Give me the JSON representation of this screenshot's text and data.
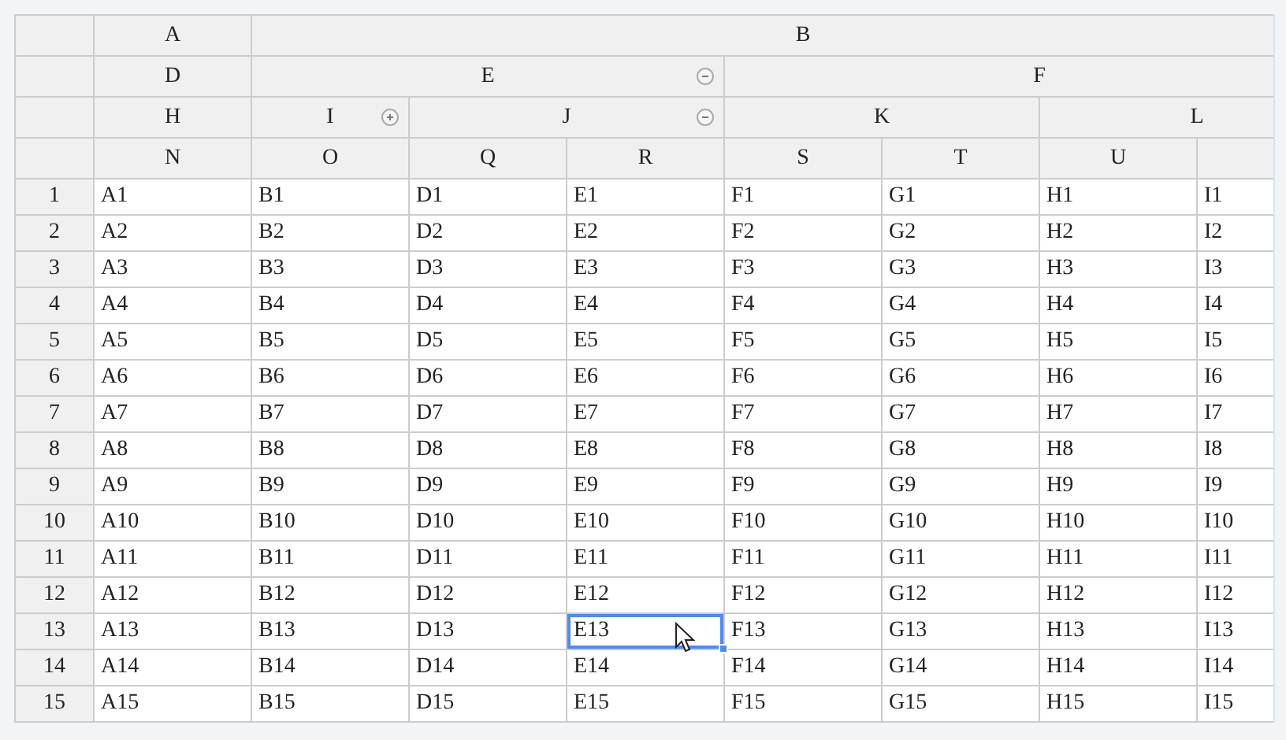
{
  "header_tree": [
    {
      "label": "A",
      "children": [
        {
          "label": "D",
          "children": [
            {
              "label": "H",
              "children": [
                {
                  "label": "N"
                }
              ]
            }
          ]
        }
      ]
    },
    {
      "label": "B",
      "children": [
        {
          "label": "E",
          "collapsible": true,
          "collapsed": false,
          "children": [
            {
              "label": "I",
              "collapsible": true,
              "collapsed": true,
              "children": [
                {
                  "label": "O"
                }
              ]
            },
            {
              "label": "J",
              "collapsible": true,
              "collapsed": false,
              "children": [
                {
                  "label": "Q"
                },
                {
                  "label": "R"
                }
              ]
            }
          ]
        },
        {
          "label": "F",
          "children": [
            {
              "label": "K",
              "children": [
                {
                  "label": "S"
                },
                {
                  "label": "T"
                }
              ]
            },
            {
              "label": "L",
              "children": [
                {
                  "label": "U"
                }
              ]
            }
          ]
        }
      ]
    }
  ],
  "rows": [
    {
      "number": "1",
      "cells": [
        {
          "text": "A1",
          "selected": false
        },
        {
          "text": "B1",
          "selected": false
        },
        {
          "text": "D1",
          "selected": false
        },
        {
          "text": "E1",
          "selected": false
        },
        {
          "text": "F1",
          "selected": false
        },
        {
          "text": "G1",
          "selected": false
        },
        {
          "text": "H1",
          "selected": false
        },
        {
          "text": "I1",
          "selected": false
        }
      ]
    },
    {
      "number": "2",
      "cells": [
        {
          "text": "A2",
          "selected": false
        },
        {
          "text": "B2",
          "selected": false
        },
        {
          "text": "D2",
          "selected": false
        },
        {
          "text": "E2",
          "selected": false
        },
        {
          "text": "F2",
          "selected": false
        },
        {
          "text": "G2",
          "selected": false
        },
        {
          "text": "H2",
          "selected": false
        },
        {
          "text": "I2",
          "selected": false
        }
      ]
    },
    {
      "number": "3",
      "cells": [
        {
          "text": "A3",
          "selected": false
        },
        {
          "text": "B3",
          "selected": false
        },
        {
          "text": "D3",
          "selected": false
        },
        {
          "text": "E3",
          "selected": false
        },
        {
          "text": "F3",
          "selected": false
        },
        {
          "text": "G3",
          "selected": false
        },
        {
          "text": "H3",
          "selected": false
        },
        {
          "text": "I3",
          "selected": false
        }
      ]
    },
    {
      "number": "4",
      "cells": [
        {
          "text": "A4",
          "selected": false
        },
        {
          "text": "B4",
          "selected": false
        },
        {
          "text": "D4",
          "selected": false
        },
        {
          "text": "E4",
          "selected": false
        },
        {
          "text": "F4",
          "selected": false
        },
        {
          "text": "G4",
          "selected": false
        },
        {
          "text": "H4",
          "selected": false
        },
        {
          "text": "I4",
          "selected": false
        }
      ]
    },
    {
      "number": "5",
      "cells": [
        {
          "text": "A5",
          "selected": false
        },
        {
          "text": "B5",
          "selected": false
        },
        {
          "text": "D5",
          "selected": false
        },
        {
          "text": "E5",
          "selected": false
        },
        {
          "text": "F5",
          "selected": false
        },
        {
          "text": "G5",
          "selected": false
        },
        {
          "text": "H5",
          "selected": false
        },
        {
          "text": "I5",
          "selected": false
        }
      ]
    },
    {
      "number": "6",
      "cells": [
        {
          "text": "A6",
          "selected": false
        },
        {
          "text": "B6",
          "selected": false
        },
        {
          "text": "D6",
          "selected": false
        },
        {
          "text": "E6",
          "selected": false
        },
        {
          "text": "F6",
          "selected": false
        },
        {
          "text": "G6",
          "selected": false
        },
        {
          "text": "H6",
          "selected": false
        },
        {
          "text": "I6",
          "selected": false
        }
      ]
    },
    {
      "number": "7",
      "cells": [
        {
          "text": "A7",
          "selected": false
        },
        {
          "text": "B7",
          "selected": false
        },
        {
          "text": "D7",
          "selected": false
        },
        {
          "text": "E7",
          "selected": false
        },
        {
          "text": "F7",
          "selected": false
        },
        {
          "text": "G7",
          "selected": false
        },
        {
          "text": "H7",
          "selected": false
        },
        {
          "text": "I7",
          "selected": false
        }
      ]
    },
    {
      "number": "8",
      "cells": [
        {
          "text": "A8",
          "selected": false
        },
        {
          "text": "B8",
          "selected": false
        },
        {
          "text": "D8",
          "selected": false
        },
        {
          "text": "E8",
          "selected": false
        },
        {
          "text": "F8",
          "selected": false
        },
        {
          "text": "G8",
          "selected": false
        },
        {
          "text": "H8",
          "selected": false
        },
        {
          "text": "I8",
          "selected": false
        }
      ]
    },
    {
      "number": "9",
      "cells": [
        {
          "text": "A9",
          "selected": false
        },
        {
          "text": "B9",
          "selected": false
        },
        {
          "text": "D9",
          "selected": false
        },
        {
          "text": "E9",
          "selected": false
        },
        {
          "text": "F9",
          "selected": false
        },
        {
          "text": "G9",
          "selected": false
        },
        {
          "text": "H9",
          "selected": false
        },
        {
          "text": "I9",
          "selected": false
        }
      ]
    },
    {
      "number": "10",
      "cells": [
        {
          "text": "A10",
          "selected": false
        },
        {
          "text": "B10",
          "selected": false
        },
        {
          "text": "D10",
          "selected": false
        },
        {
          "text": "E10",
          "selected": false
        },
        {
          "text": "F10",
          "selected": false
        },
        {
          "text": "G10",
          "selected": false
        },
        {
          "text": "H10",
          "selected": false
        },
        {
          "text": "I10",
          "selected": false
        }
      ]
    },
    {
      "number": "11",
      "cells": [
        {
          "text": "A11",
          "selected": false
        },
        {
          "text": "B11",
          "selected": false
        },
        {
          "text": "D11",
          "selected": false
        },
        {
          "text": "E11",
          "selected": false
        },
        {
          "text": "F11",
          "selected": false
        },
        {
          "text": "G11",
          "selected": false
        },
        {
          "text": "H11",
          "selected": false
        },
        {
          "text": "I11",
          "selected": false
        }
      ]
    },
    {
      "number": "12",
      "cells": [
        {
          "text": "A12",
          "selected": false
        },
        {
          "text": "B12",
          "selected": false
        },
        {
          "text": "D12",
          "selected": false
        },
        {
          "text": "E12",
          "selected": false
        },
        {
          "text": "F12",
          "selected": false
        },
        {
          "text": "G12",
          "selected": false
        },
        {
          "text": "H12",
          "selected": false
        },
        {
          "text": "I12",
          "selected": false
        }
      ]
    },
    {
      "number": "13",
      "cells": [
        {
          "text": "A13",
          "selected": false
        },
        {
          "text": "B13",
          "selected": false
        },
        {
          "text": "D13",
          "selected": false
        },
        {
          "text": "E13",
          "selected": true
        },
        {
          "text": "F13",
          "selected": false
        },
        {
          "text": "G13",
          "selected": false
        },
        {
          "text": "H13",
          "selected": false
        },
        {
          "text": "I13",
          "selected": false
        }
      ]
    },
    {
      "number": "14",
      "cells": [
        {
          "text": "A14",
          "selected": false
        },
        {
          "text": "B14",
          "selected": false
        },
        {
          "text": "D14",
          "selected": false
        },
        {
          "text": "E14",
          "selected": false
        },
        {
          "text": "F14",
          "selected": false
        },
        {
          "text": "G14",
          "selected": false
        },
        {
          "text": "H14",
          "selected": false
        },
        {
          "text": "I14",
          "selected": false
        }
      ]
    },
    {
      "number": "15",
      "cells": [
        {
          "text": "A15",
          "selected": false
        },
        {
          "text": "B15",
          "selected": false
        },
        {
          "text": "D15",
          "selected": false
        },
        {
          "text": "E15",
          "selected": false
        },
        {
          "text": "F15",
          "selected": false
        },
        {
          "text": "G15",
          "selected": false
        },
        {
          "text": "H15",
          "selected": false
        },
        {
          "text": "I15",
          "selected": false
        }
      ]
    }
  ]
}
